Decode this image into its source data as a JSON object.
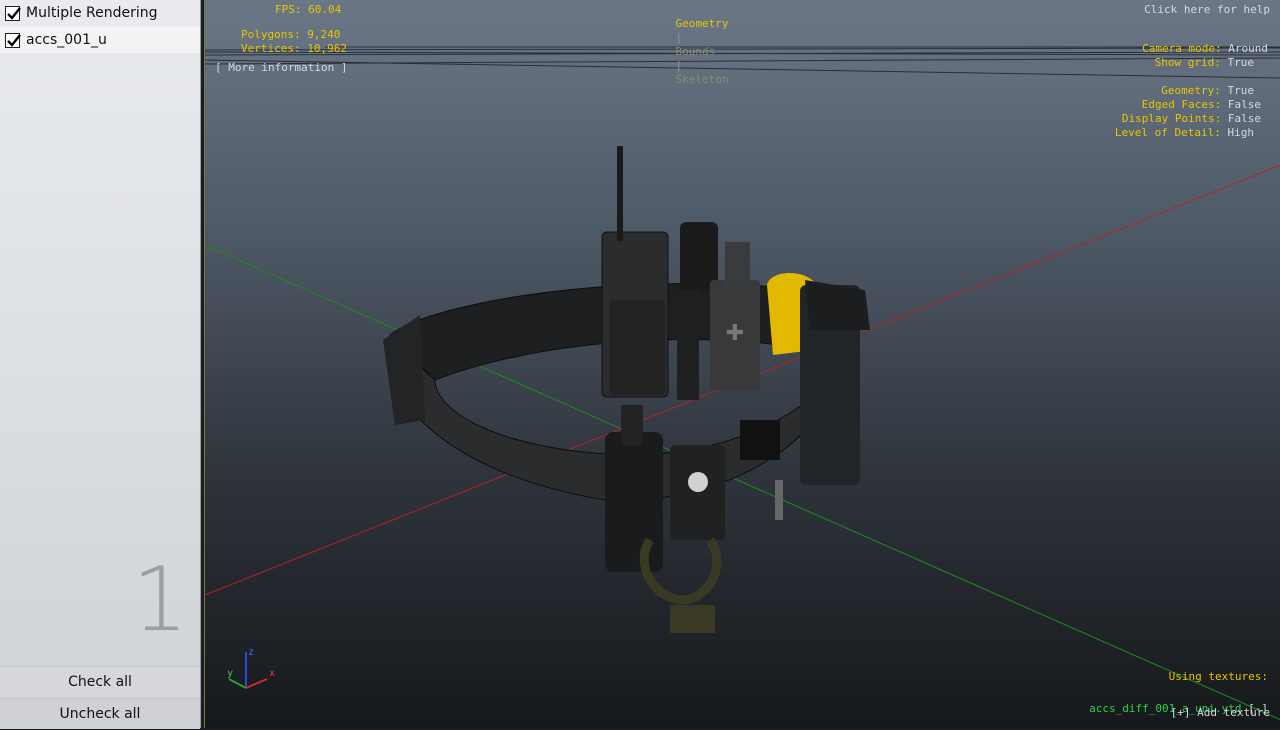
{
  "sidebar": {
    "header": {
      "label": "Multiple Rendering",
      "checked": true
    },
    "items": [
      {
        "label": "accs_001_u",
        "checked": true
      }
    ],
    "count": "1",
    "check_all": "Check all",
    "uncheck_all": "Uncheck all"
  },
  "hud": {
    "fps": "FPS: 60.04",
    "polygons": "Polygons: 9,240",
    "vertices": "Vertices: 10,962",
    "more_info": "[ More information ]",
    "tabs": {
      "geometry": "Geometry",
      "bounds": "Bounds",
      "skeleton": "Skeleton",
      "sep": "|"
    },
    "help": "Click here for help",
    "camera_mode": {
      "label": "Camera mode:",
      "value": "Around"
    },
    "show_grid": {
      "label": "Show grid:",
      "value": "True"
    },
    "geometry": {
      "label": "Geometry:",
      "value": "True"
    },
    "edged_faces": {
      "label": "Edged Faces:",
      "value": "False"
    },
    "display_points": {
      "label": "Display Points:",
      "value": "False"
    },
    "lod": {
      "label": "Level of Detail:",
      "value": "High"
    },
    "using_textures": "Using textures:",
    "texture_file": "accs_diff_001_a_uni.ytd",
    "texture_remove": "[-]",
    "add_texture": "[+] Add texture"
  },
  "axes": {
    "x": "x",
    "y": "y",
    "z": "z"
  },
  "colors": {
    "hud_yellow": "#e7c600",
    "hud_white": "#d5d8dd",
    "texture_green": "#2bd24a",
    "axis_red": "#d02a2a",
    "axis_green": "#2aa02a",
    "axis_blue": "#2a4ad0"
  }
}
